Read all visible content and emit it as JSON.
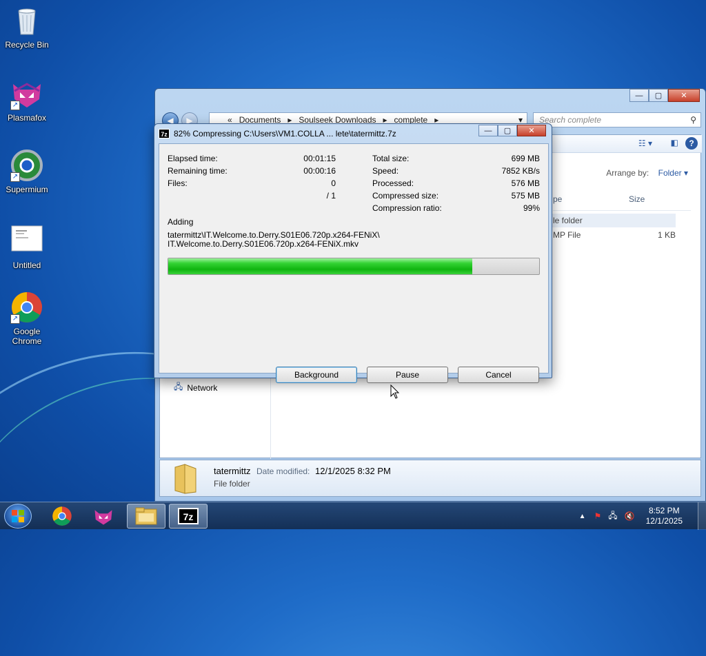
{
  "desktop": {
    "icons": [
      {
        "label": "Recycle Bin"
      },
      {
        "label": "Plasmafox"
      },
      {
        "label": "Supermium"
      },
      {
        "label": "Untitled"
      },
      {
        "label": "Google Chrome"
      }
    ]
  },
  "explorer": {
    "breadcrumb": [
      "Documents",
      "Soulseek Downloads",
      "complete"
    ],
    "search_placeholder": "Search complete",
    "arrange_by_label": "Arrange by:",
    "arrange_by_value": "Folder",
    "columns": {
      "type": "pe",
      "size": "Size"
    },
    "rows": [
      {
        "type": "le folder",
        "size": ""
      },
      {
        "type": "MP File",
        "size": "1 KB"
      }
    ],
    "nav_network": "Network",
    "details": {
      "name": "tatermittz",
      "modified_label": "Date modified:",
      "modified_value": "12/1/2025 8:32 PM",
      "type": "File folder"
    }
  },
  "dialog": {
    "title": "82% Compressing C:\\Users\\VM1.COLLA ... lete\\tatermittz.7z",
    "left_stats": [
      {
        "label": "Elapsed time:",
        "value": "00:01:15"
      },
      {
        "label": "Remaining time:",
        "value": "00:00:16"
      },
      {
        "label": "Files:",
        "value": "0"
      },
      {
        "label": "",
        "value": "/ 1"
      }
    ],
    "right_stats": [
      {
        "label": "Total size:",
        "value": "699 MB"
      },
      {
        "label": "Speed:",
        "value": "7852 KB/s"
      },
      {
        "label": "Processed:",
        "value": "576 MB"
      },
      {
        "label": "Compressed size:",
        "value": "575 MB"
      },
      {
        "label": "Compression ratio:",
        "value": "99%"
      }
    ],
    "adding_label": "Adding",
    "path_line1": "tatermittz\\IT.Welcome.to.Derry.S01E06.720p.x264-FENiX\\",
    "path_line2": "IT.Welcome.to.Derry.S01E06.720p.x264-FENiX.mkv",
    "progress_fraction": 0.82,
    "buttons": {
      "background": "Background",
      "pause": "Pause",
      "cancel": "Cancel"
    }
  },
  "taskbar": {
    "clock_time": "8:52 PM",
    "clock_date": "12/1/2025"
  },
  "colors": {
    "progress": "#1fc421",
    "accent": "#1f6cc8"
  }
}
